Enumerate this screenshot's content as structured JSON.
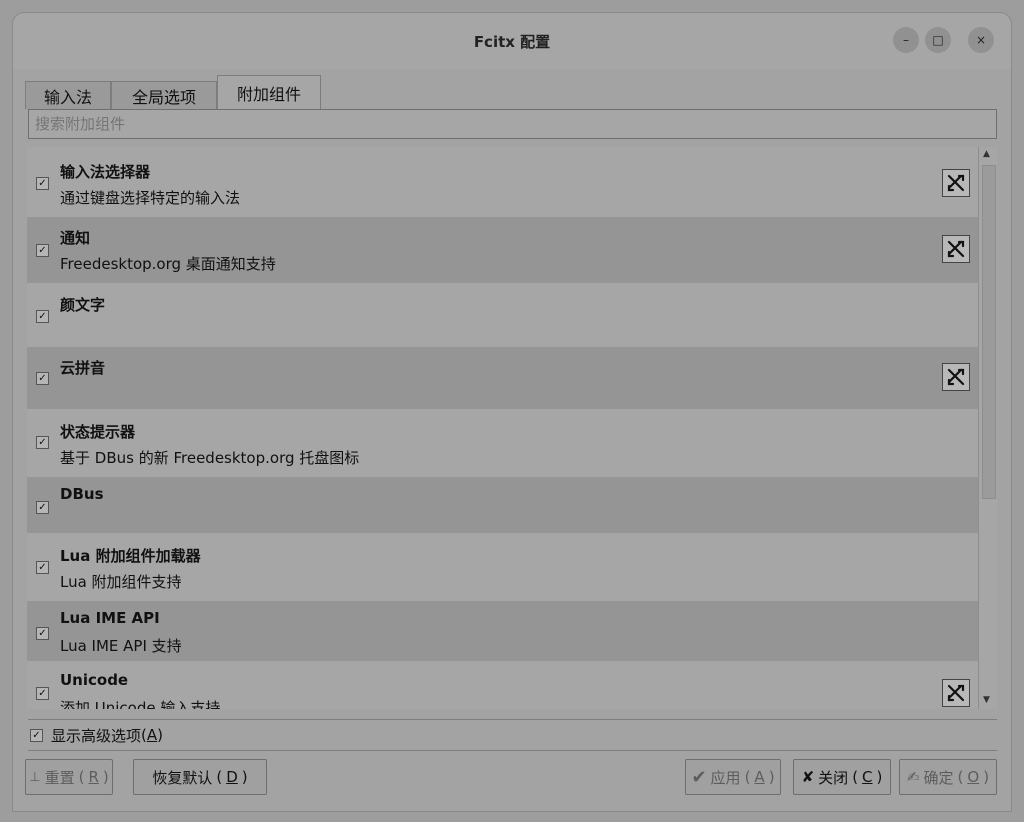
{
  "window": {
    "title": "Fcitx 配置",
    "controls": {
      "minimize": "–",
      "maximize": "□",
      "close": "×"
    }
  },
  "tabs": [
    {
      "label": "输入法",
      "active": false
    },
    {
      "label": "全局选项",
      "active": false
    },
    {
      "label": "附加组件",
      "active": true
    }
  ],
  "search": {
    "placeholder": "搜索附加组件",
    "value": ""
  },
  "addons": [
    {
      "name": "输入法选择器",
      "description": "通过键盘选择特定的输入法",
      "checked": true,
      "configurable": true
    },
    {
      "name": "通知",
      "description": "Freedesktop.org 桌面通知支持",
      "checked": true,
      "configurable": true
    },
    {
      "name": "颜文字",
      "description": "",
      "checked": true,
      "configurable": false
    },
    {
      "name": "云拼音",
      "description": "",
      "checked": true,
      "configurable": true
    },
    {
      "name": "状态提示器",
      "description": "基于 DBus 的新 Freedesktop.org 托盘图标",
      "checked": true,
      "configurable": false
    },
    {
      "name": "DBus",
      "description": "",
      "checked": true,
      "configurable": false
    },
    {
      "name": "Lua 附加组件加载器",
      "description": "Lua 附加组件支持",
      "checked": true,
      "configurable": false
    },
    {
      "name": "Lua IME API",
      "description": "Lua IME API 支持",
      "checked": true,
      "configurable": false
    },
    {
      "name": "Unicode",
      "description": "添加 Unicode 输入支持",
      "checked": true,
      "configurable": true
    }
  ],
  "advanced": {
    "label": "显示高级选项",
    "mnemonic": "A",
    "checked": true
  },
  "buttons": {
    "reset": {
      "label": "重置",
      "mnemonic": "R",
      "icon": "reset-icon"
    },
    "defaults": {
      "label": "恢复默认",
      "mnemonic": "D"
    },
    "apply": {
      "label": "应用",
      "mnemonic": "A",
      "icon": "check-icon"
    },
    "close": {
      "label": "关闭",
      "mnemonic": "C",
      "icon": "x-icon"
    },
    "ok": {
      "label": "确定",
      "mnemonic": "O",
      "icon": "ok-icon"
    }
  },
  "check_glyph": "✓"
}
